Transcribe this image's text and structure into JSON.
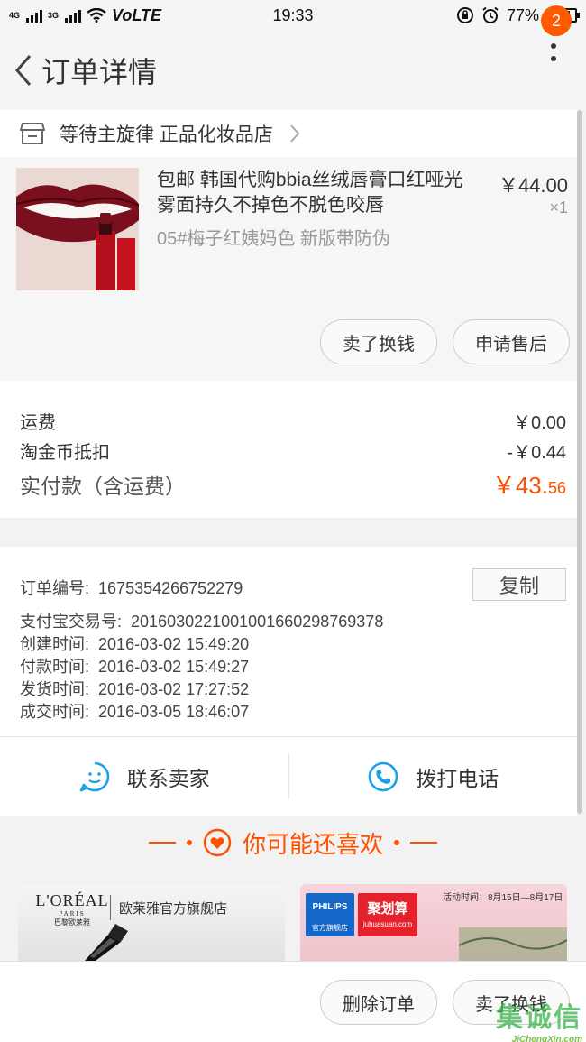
{
  "status_bar": {
    "net1": "4G",
    "net2": "3G",
    "volte": "VoLTE",
    "time": "19:33",
    "battery": "77%"
  },
  "header": {
    "title": "订单详情",
    "badge_count": "2"
  },
  "shop": {
    "name": "等待主旋律 正品化妆品店"
  },
  "product": {
    "title": "包邮 韩国代购bbia丝绒唇膏口红哑光雾面持久不掉色不脱色咬唇",
    "sku": "05#梅子红姨妈色 新版带防伪",
    "price": "￥44.00",
    "qty": "×1",
    "actions": [
      "卖了换钱",
      "申请售后"
    ]
  },
  "fees": {
    "shipping_label": "运费",
    "shipping_value": "￥0.00",
    "coin_label": "淘金币抵扣",
    "coin_value": "-￥0.44",
    "total_label": "实付款（含运费）",
    "total_main": "￥43.",
    "total_cents": "56",
    "accent": "#ff5000"
  },
  "order_info": {
    "order_no_label": "订单编号:",
    "order_no": "1675354266752279",
    "copy_label": "复制",
    "alipay_label": "支付宝交易号:",
    "alipay_no": "2016030221001001660298769378",
    "created_label": "创建时间:",
    "created": "2016-03-02 15:49:20",
    "paid_label": "付款时间:",
    "paid": "2016-03-02 15:49:27",
    "shipped_label": "发货时间:",
    "shipped": "2016-03-02 17:27:52",
    "done_label": "成交时间:",
    "done": "2016-03-05 18:46:07"
  },
  "contact": {
    "seller_label": "联系卖家",
    "phone_label": "拨打电话"
  },
  "recommend": {
    "title": "你可能还喜欢",
    "card1_brand": "L'ORÉAL",
    "card1_brand_sub": "PARIS",
    "card1_brand_cn": "巴黎欧莱雅",
    "card1_store": "欧莱雅官方旗舰店",
    "card2_brand": "PHILIPS",
    "card2_brand_sub": "官方旗舰店",
    "card2_promo": "聚划算",
    "card2_promo_sub": "juhuasuan.com",
    "card2_date": "活动时间：8月15日—8月17日"
  },
  "bottom_bar": {
    "delete_label": "删除订单",
    "sell_label": "卖了换钱"
  },
  "watermark": {
    "text": "集诚信",
    "url": "JiChengXin.com"
  }
}
